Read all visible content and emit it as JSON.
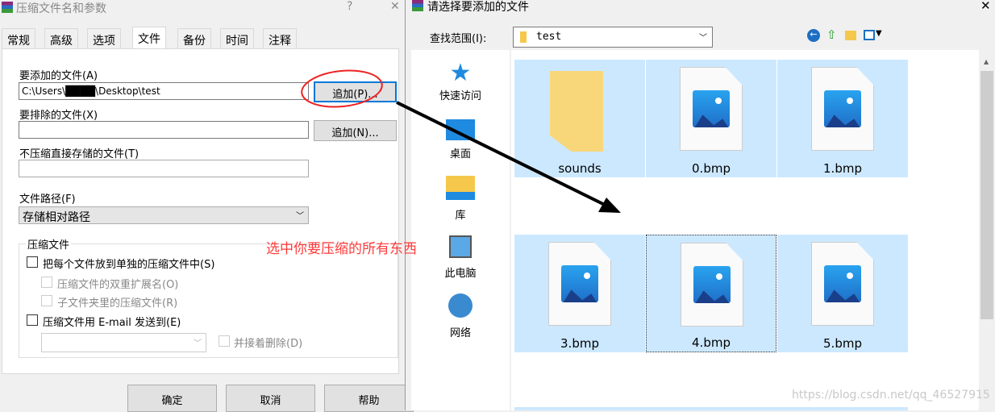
{
  "left_dialog": {
    "title": "压缩文件名和参数",
    "help": "?",
    "close": "✕",
    "tabs": [
      "常规",
      "高级",
      "选项",
      "文件",
      "备份",
      "时间",
      "注释"
    ],
    "active_tab": "文件",
    "files_to_add_label": "要添加的文件(A)",
    "files_to_add_value": "C:\\Users\\████\\Desktop\\test",
    "add_button_1": "追加(P)...",
    "exclude_label": "要排除的文件(X)",
    "exclude_value": "",
    "add_button_2": "追加(N)...",
    "store_label": "不压缩直接存储的文件(T)",
    "store_value": "",
    "path_label": "文件路径(F)",
    "path_value": "存储相对路径",
    "group_label": "压缩文件",
    "options": [
      "把每个文件放到单独的压缩文件中(S)",
      "压缩文件的双重扩展名(O)",
      "子文件夹里的压缩文件(R)",
      "压缩文件用 E-mail 发送到(E)"
    ],
    "delete_after": "并接着删除(D)",
    "ok": "确定",
    "cancel": "取消",
    "help_btn": "帮助"
  },
  "right_dialog": {
    "title": "请选择要添加的文件",
    "close": "✕",
    "look_in_label": "查找范围(I):",
    "look_in_value": "test",
    "nav": [
      "快速访问",
      "桌面",
      "库",
      "此电脑",
      "网络"
    ],
    "files": [
      "sounds",
      "0.bmp",
      "1.bmp",
      "3.bmp",
      "4.bmp",
      "5.bmp"
    ]
  },
  "annotation": {
    "text": "选中你要压缩的所有东西",
    "color": "#ff3b3b"
  },
  "watermark": "https://blog.csdn.net/qq_46527915"
}
